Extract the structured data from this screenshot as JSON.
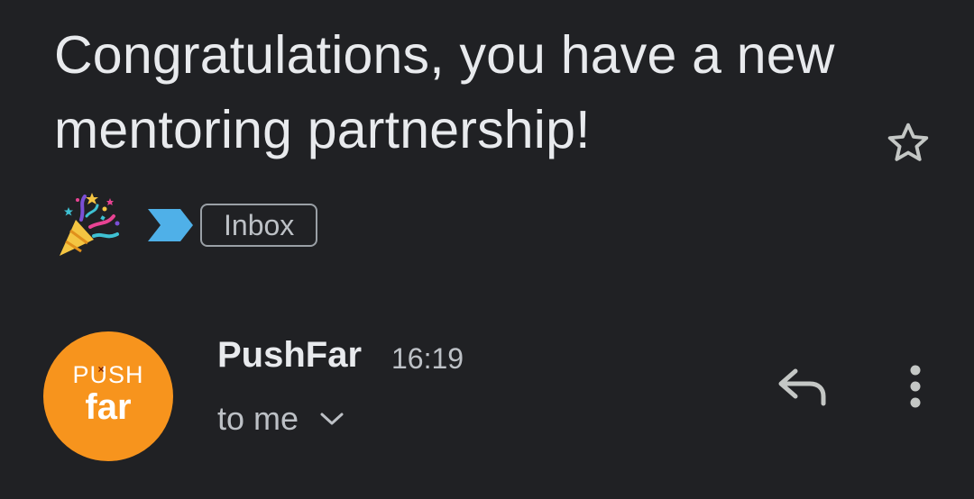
{
  "email": {
    "subject": "Congratulations, you have a new mentoring partnership!",
    "label": "Inbox",
    "starred": false
  },
  "icons": {
    "emoji": "party-popper-icon",
    "importance": "importance-marker-icon",
    "star": "star-outline-icon",
    "reply": "reply-icon",
    "more": "more-vert-icon",
    "expand": "chevron-down-icon"
  },
  "sender": {
    "name": "PushFar",
    "time": "16:19",
    "avatar": {
      "top_text": "PUSH",
      "bottom_text": "far",
      "color": "#f7941d"
    }
  },
  "recipient": {
    "text": "to me"
  },
  "colors": {
    "background": "#202124",
    "importance_marker": "#4fb0e8"
  }
}
